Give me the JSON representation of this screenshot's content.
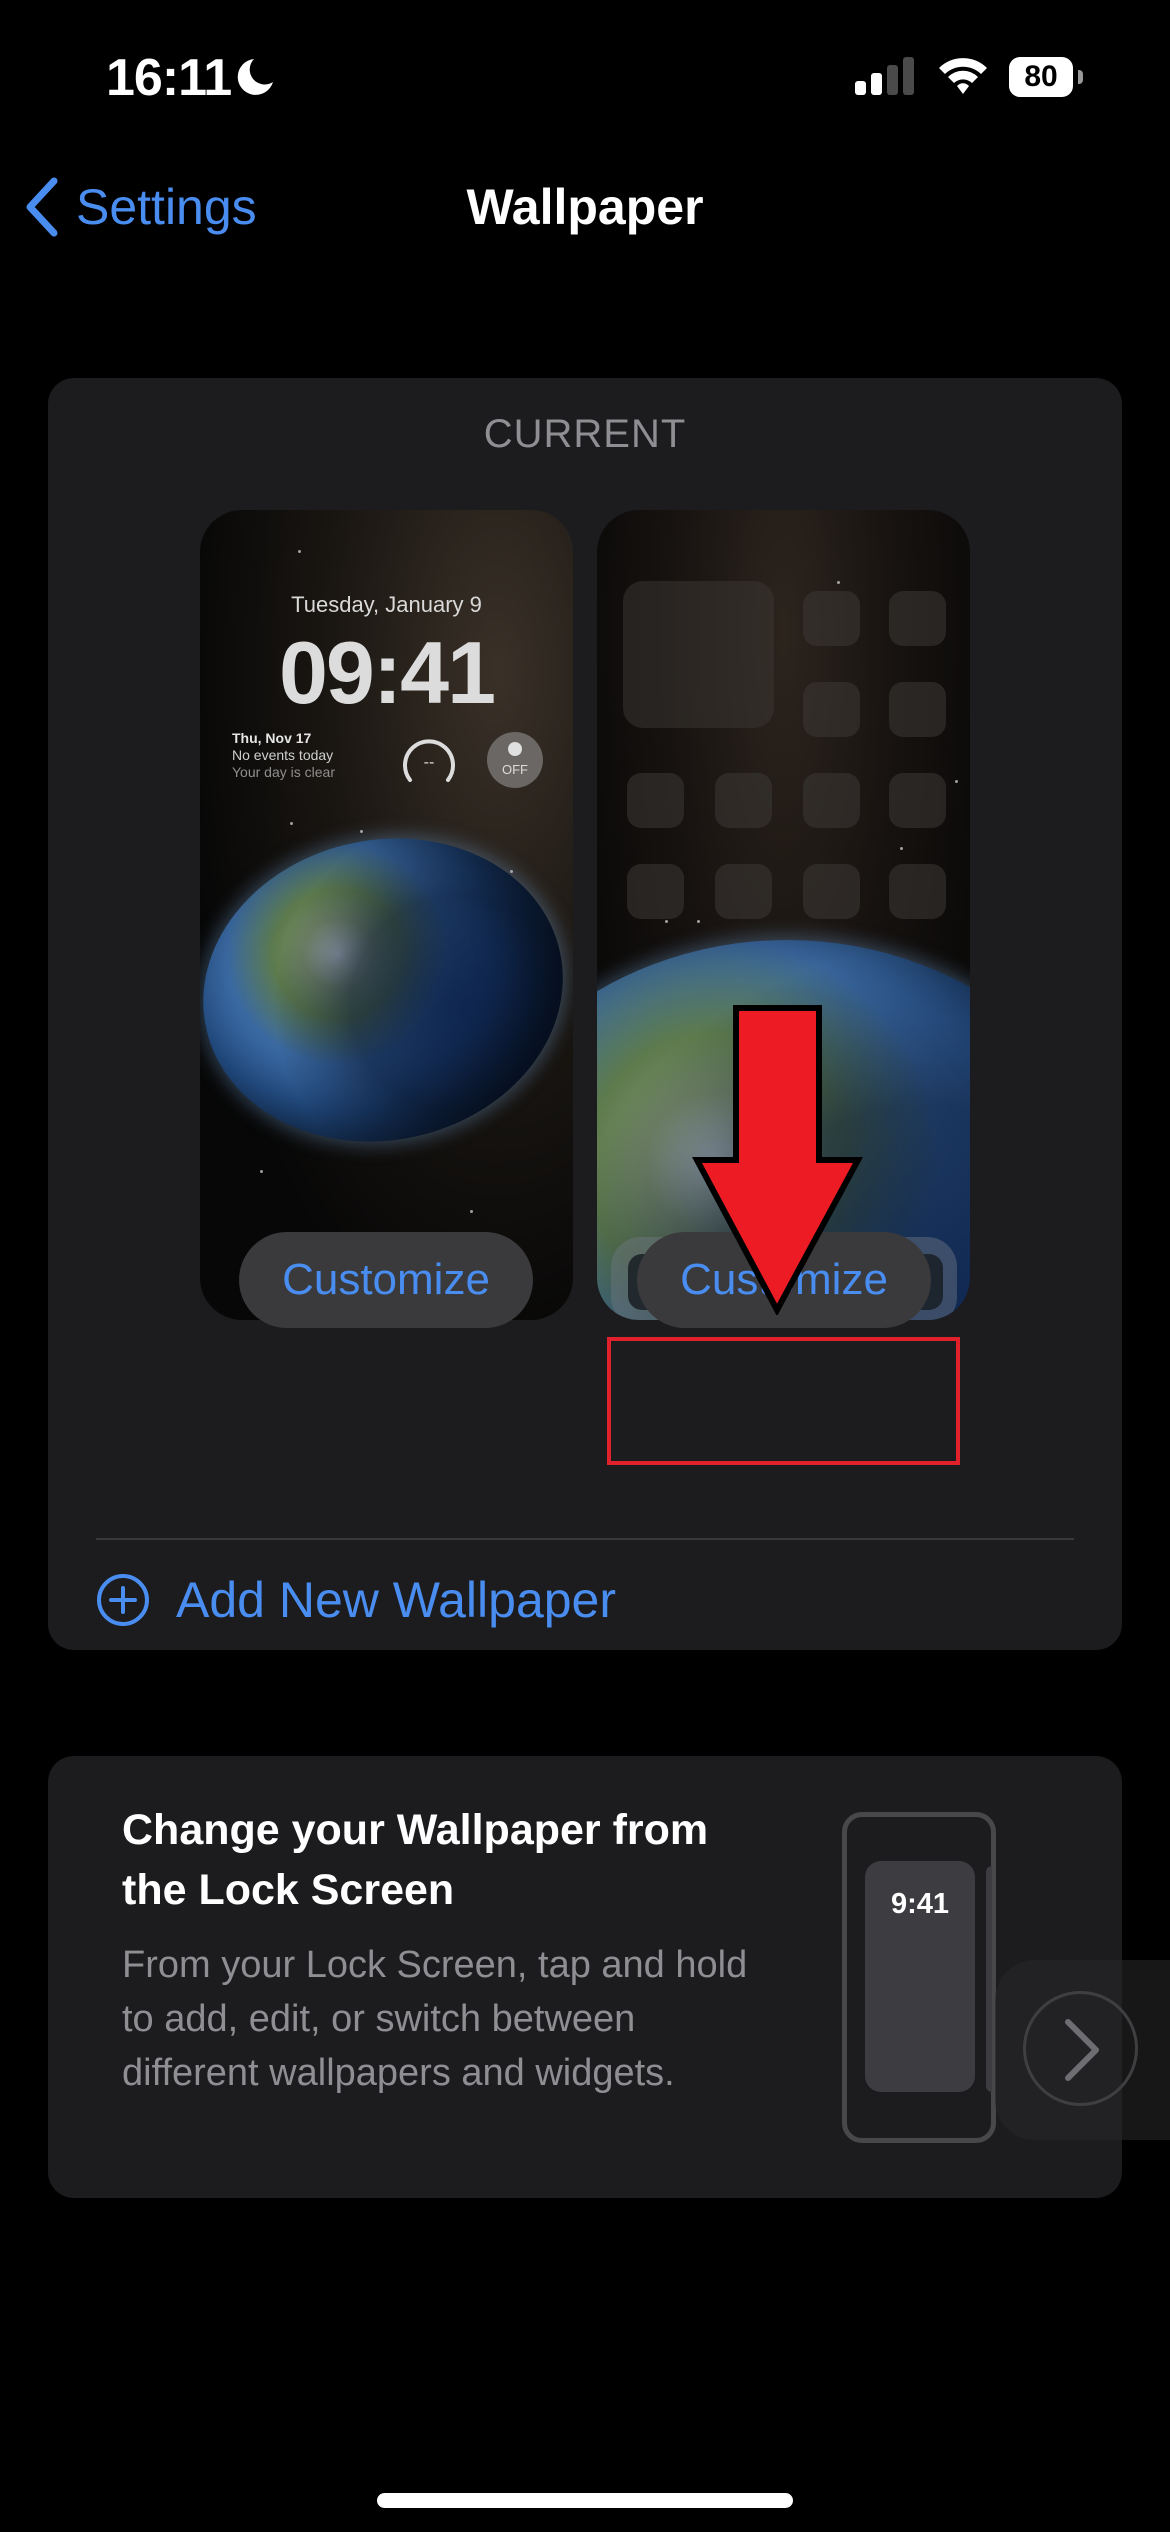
{
  "status_bar": {
    "time": "16:11",
    "focus_icon": "moon-icon",
    "signal_bars_filled": 2,
    "signal_bars_total": 4,
    "wifi_icon": "wifi-icon",
    "battery_level": "80"
  },
  "nav": {
    "back_label": "Settings",
    "title": "Wallpaper"
  },
  "current_section": {
    "label": "CURRENT",
    "lock_screen_preview": {
      "date": "Tuesday, January 9",
      "time": "09:41",
      "calendar_widget": {
        "date": "Thu, Nov 17",
        "events": "No events today",
        "subtitle": "Your day is clear"
      },
      "gauge_widget_value": "--",
      "alarm_widget_label": "OFF"
    },
    "home_screen_preview": {
      "icon_rows": 4,
      "dock_icons": 4
    },
    "customize_lock_label": "Customize",
    "customize_home_label": "Customize",
    "add_new_label": "Add New Wallpaper"
  },
  "annotation": {
    "arrow_color": "#ed1c24",
    "box_color": "#e0202b",
    "target": "customize-home-button"
  },
  "tip_card": {
    "title": "Change your Wallpaper from the Lock Screen",
    "body": "From your Lock Screen, tap and hold to add, edit, or switch between different wallpapers and widgets.",
    "illustration_time": "9:41"
  },
  "colors": {
    "accent": "#4a8df0",
    "card_bg": "#1c1c1e",
    "secondary_text": "#8e8e93",
    "button_bg": "#3a3a3c"
  }
}
